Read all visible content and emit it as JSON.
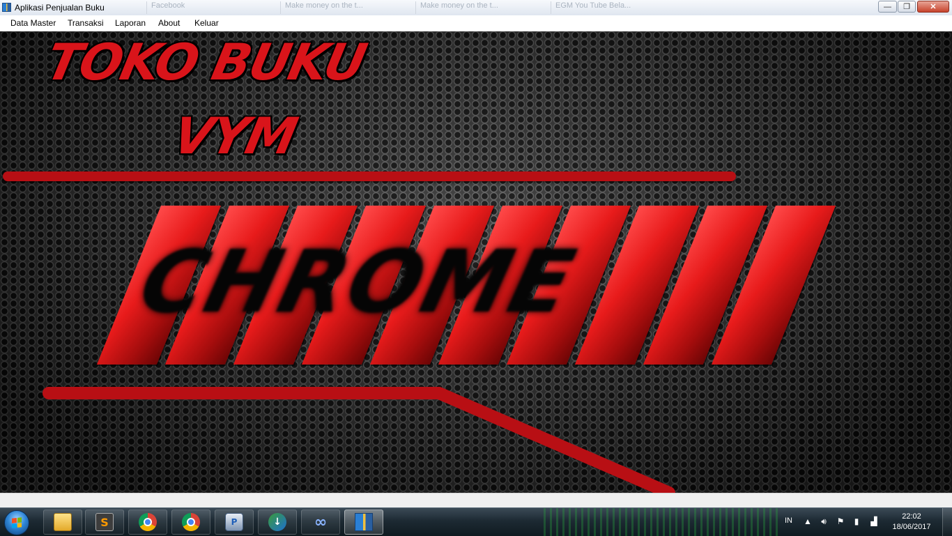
{
  "window": {
    "title": "Aplikasi Penjualan Buku",
    "background_tabs": [
      "Facebook",
      "Make money on the t...",
      "Make money on the t...",
      "EGM You Tube Bela...",
      ""
    ],
    "buttons": {
      "minimize": "—",
      "maximize": "❐",
      "close": "✕"
    }
  },
  "menu": {
    "items": [
      "Data Master",
      "Transaksi",
      "Laporan",
      "About",
      "Keluar"
    ]
  },
  "banner": {
    "brand_line1": "TOKO BUKU",
    "brand_line2": "VYM",
    "chrome_text": "CHROME",
    "accent_color": "#d9141a"
  },
  "taskbar": {
    "apps": [
      {
        "name": "windows-explorer",
        "icon": "folder-icon"
      },
      {
        "name": "sublime-text",
        "icon": "sublime-icon",
        "glyph": "S"
      },
      {
        "name": "google-chrome",
        "icon": "chrome-icon"
      },
      {
        "name": "google-chrome",
        "icon": "chrome-icon"
      },
      {
        "name": "printer-app",
        "icon": "printer-icon",
        "glyph": "P"
      },
      {
        "name": "internet-download-manager",
        "icon": "idm-icon",
        "glyph": "↓"
      },
      {
        "name": "infinity-app",
        "icon": "infinity-icon",
        "glyph": "∞"
      },
      {
        "name": "aplikasi-penjualan-buku",
        "icon": "book-app-icon"
      }
    ],
    "language": "IN",
    "time": "22:02",
    "date": "18/06/2017"
  }
}
